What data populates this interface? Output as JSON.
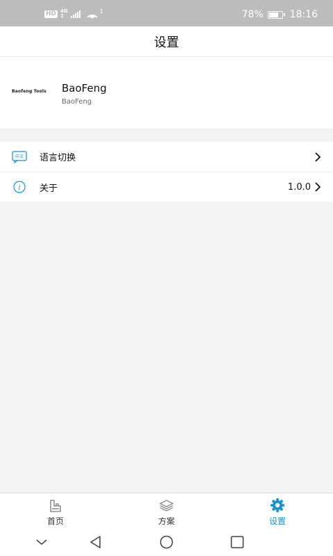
{
  "status_bar": {
    "hd": "HD",
    "network": "4G",
    "network_sub": "1",
    "hotspot_count": "1",
    "battery_percent_text": "78%",
    "battery_level": 0.78,
    "time": "18:16"
  },
  "header": {
    "title": "设置"
  },
  "profile": {
    "logo_text": "Baofeng Tools",
    "name": "BaoFeng",
    "subtitle": "BaoFeng"
  },
  "settings": {
    "items": [
      {
        "label": "语言切换",
        "icon": "language-icon",
        "icon_text": "中文",
        "value": ""
      },
      {
        "label": "关于",
        "icon": "info-icon",
        "icon_text": "i",
        "value": "1.0.0"
      }
    ]
  },
  "tab_bar": {
    "active_color": "#1692d2",
    "items": [
      {
        "label": "首页",
        "icon": "home-icon",
        "active": false
      },
      {
        "label": "方案",
        "icon": "layers-icon",
        "active": false
      },
      {
        "label": "设置",
        "icon": "gear-icon",
        "active": true
      }
    ]
  },
  "system_nav": [
    "collapse-icon",
    "back-icon",
    "home-circle-icon",
    "recents-icon"
  ]
}
